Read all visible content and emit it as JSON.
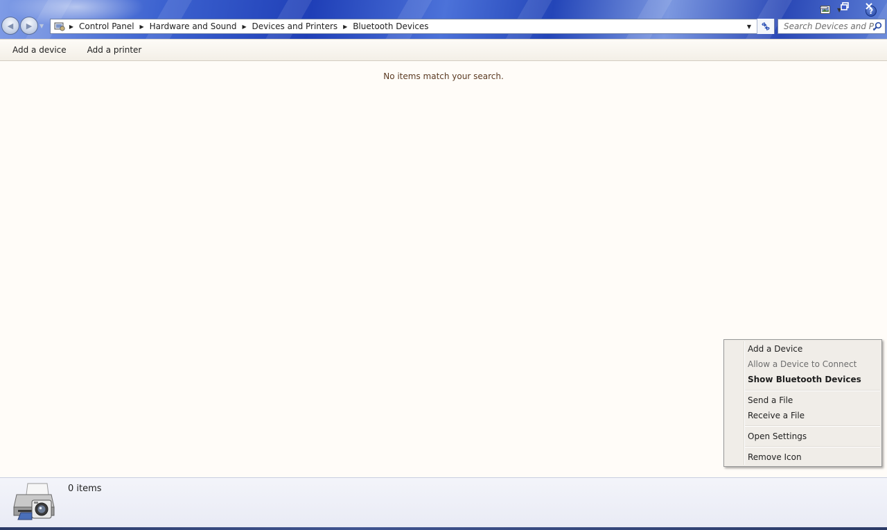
{
  "window": {
    "minimize_icon": "minimize-icon",
    "restore_icon": "restore-icon",
    "close_icon": "close-icon"
  },
  "address": {
    "breadcrumbs": [
      "Control Panel",
      "Hardware and Sound",
      "Devices and Printers",
      "Bluetooth Devices"
    ]
  },
  "search": {
    "placeholder": "Search Devices and P..."
  },
  "toolbar": {
    "add_device": "Add a device",
    "add_printer": "Add a printer",
    "help_label": "?"
  },
  "content": {
    "empty_message": "No items match your search."
  },
  "details": {
    "count": "0 items"
  },
  "context_menu": {
    "items": [
      {
        "label": "Add a Device",
        "state": "normal"
      },
      {
        "label": "Allow a Device to Connect",
        "state": "disabled"
      },
      {
        "label": "Show Bluetooth Devices",
        "state": "default"
      },
      {
        "label": "Send a File",
        "state": "normal"
      },
      {
        "label": "Receive a File",
        "state": "normal"
      },
      {
        "label": "Open Settings",
        "state": "normal"
      },
      {
        "label": "Remove Icon",
        "state": "normal"
      }
    ]
  },
  "colors": {
    "content_bg": "#fffcf8",
    "menu_bg": "#f0ede8",
    "empty_text": "#5b3a22"
  }
}
